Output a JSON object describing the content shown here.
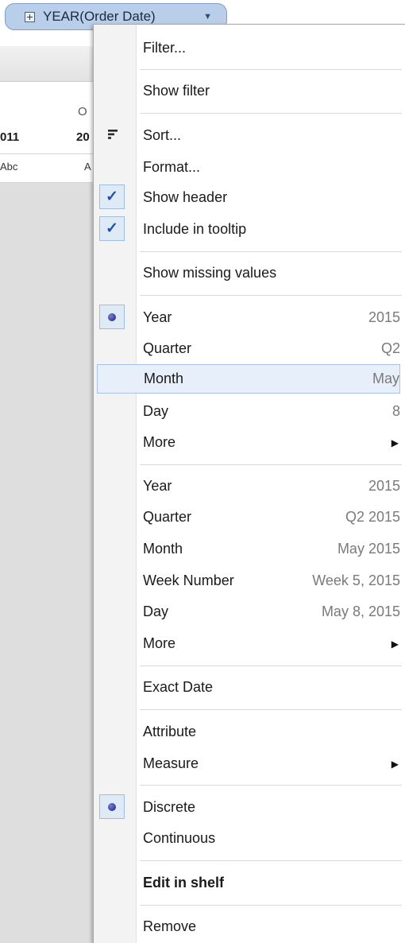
{
  "pill": {
    "label": "YEAR(Order Date)"
  },
  "worksheet": {
    "header_partial": "O",
    "column_1": "011",
    "column_2": "20",
    "cell_1": "Abc",
    "cell_2": "A"
  },
  "menu": {
    "filter": "Filter...",
    "show_filter": "Show filter",
    "sort": "Sort...",
    "format": "Format...",
    "show_header": "Show header",
    "include_in_tooltip": "Include in tooltip",
    "show_missing_values": "Show missing values",
    "date_parts": [
      {
        "label": "Year",
        "value": "2015",
        "selected": true
      },
      {
        "label": "Quarter",
        "value": "Q2"
      },
      {
        "label": "Month",
        "value": "May",
        "highlighted": true
      },
      {
        "label": "Day",
        "value": "8"
      },
      {
        "label": "More",
        "submenu": true
      }
    ],
    "date_values": [
      {
        "label": "Year",
        "value": "2015"
      },
      {
        "label": "Quarter",
        "value": "Q2 2015"
      },
      {
        "label": "Month",
        "value": "May 2015"
      },
      {
        "label": "Week Number",
        "value": "Week 5, 2015"
      },
      {
        "label": "Day",
        "value": "May 8, 2015"
      },
      {
        "label": "More",
        "submenu": true
      }
    ],
    "exact_date": "Exact Date",
    "attribute": "Attribute",
    "measure": "Measure",
    "discrete": "Discrete",
    "continuous": "Continuous",
    "edit_in_shelf": "Edit in shelf",
    "remove": "Remove"
  },
  "icons": {
    "checked": "check-icon",
    "radio_selected": "radio-dot-icon",
    "sort": "sort-icon",
    "submenu": "triangle-right-icon",
    "pill_dropdown": "triangle-down-icon",
    "pill_expand": "plus-box-icon"
  },
  "colors": {
    "pill_background": "#b9cfe9",
    "highlight_background": "#e7f0fa",
    "check_mark": "#2150a6"
  }
}
